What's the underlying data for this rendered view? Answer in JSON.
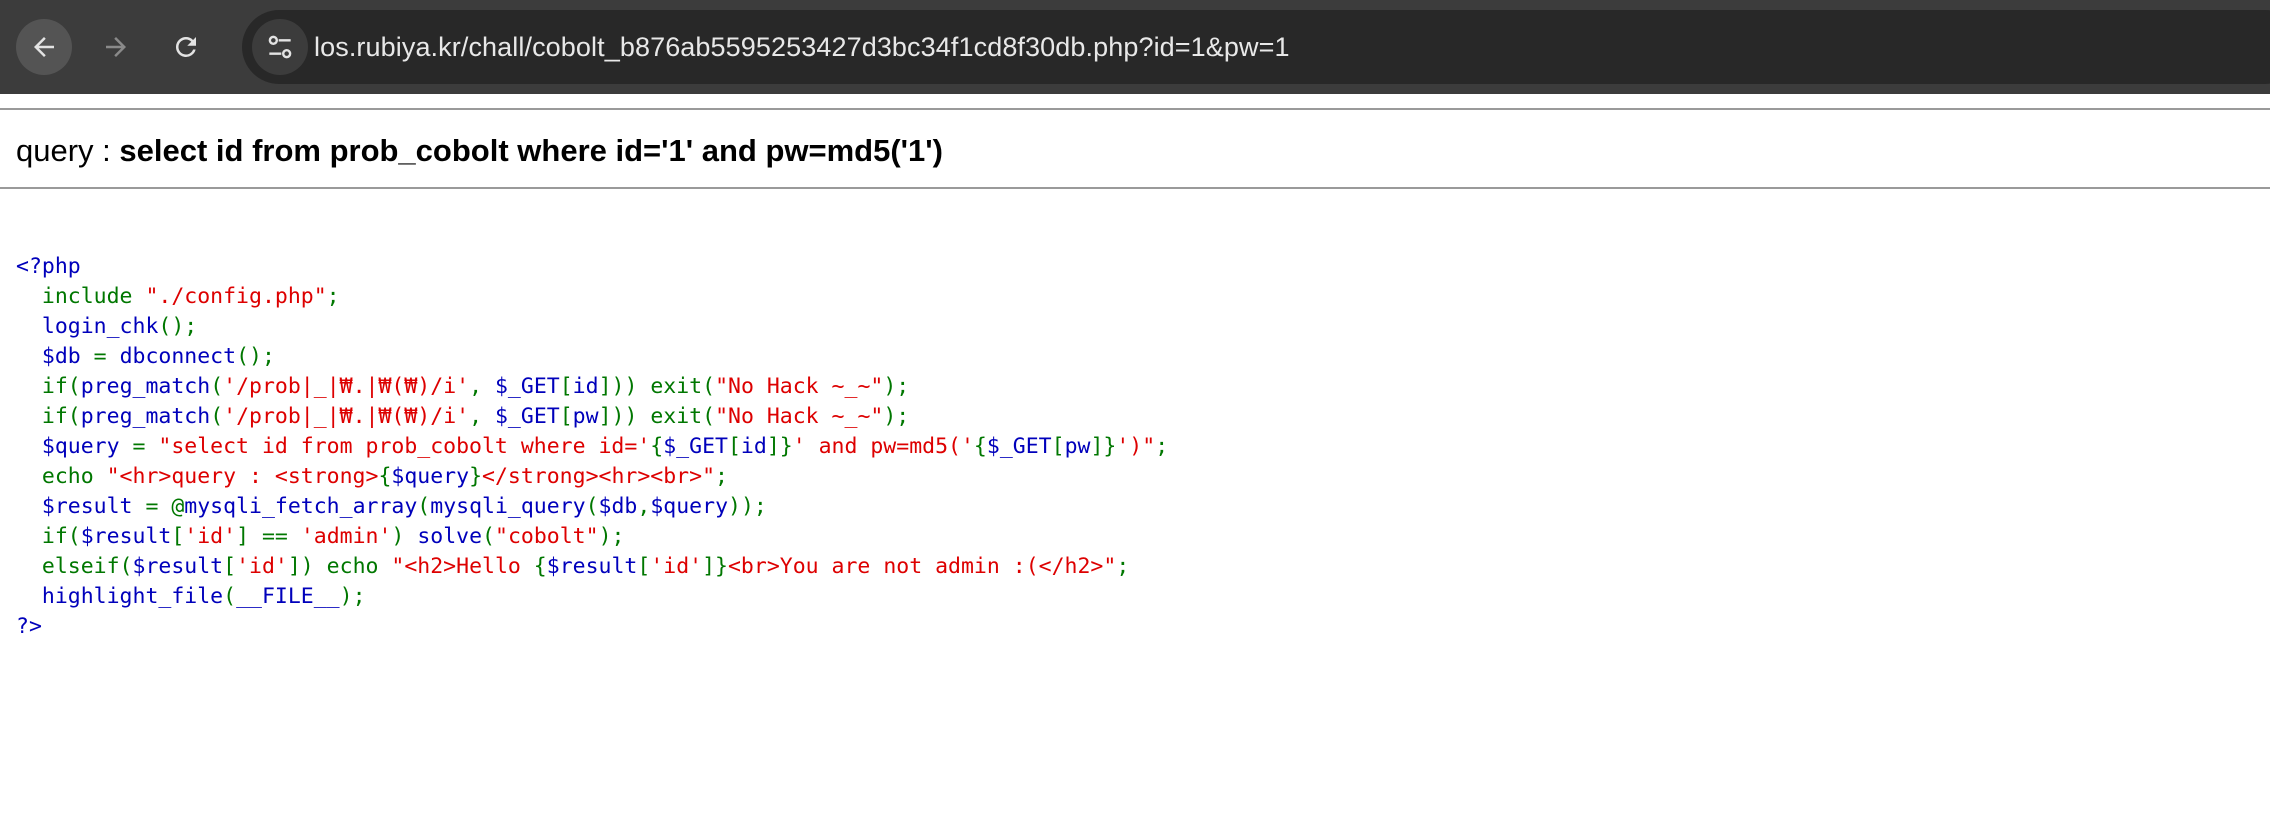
{
  "browser": {
    "url": "los.rubiya.kr/chall/cobolt_b876ab5595253427d3bc34f1cd8f30db.php?id=1&pw=1",
    "back_icon": "arrow-left-icon",
    "forward_icon": "arrow-right-icon",
    "reload_icon": "reload-icon",
    "site_info_icon": "tune-icon"
  },
  "page": {
    "query_label": "query : ",
    "query_text": "select id from prob_cobolt where id='1' and pw=md5('1')"
  },
  "source_code": [
    [
      [
        "blue",
        "<?php"
      ]
    ],
    [
      [
        "green",
        "  include "
      ],
      [
        "red",
        "\"./config.php\""
      ],
      [
        "green",
        ";"
      ]
    ],
    [
      [
        "green",
        "  "
      ],
      [
        "blue",
        "login_chk"
      ],
      [
        "green",
        "();"
      ]
    ],
    [
      [
        "green",
        "  "
      ],
      [
        "blue",
        "$db "
      ],
      [
        "green",
        "= "
      ],
      [
        "blue",
        "dbconnect"
      ],
      [
        "green",
        "();"
      ]
    ],
    [
      [
        "green",
        "  if("
      ],
      [
        "blue",
        "preg_match"
      ],
      [
        "green",
        "("
      ],
      [
        "red",
        "'/prob|_|₩.|₩(₩)/i'"
      ],
      [
        "green",
        ", "
      ],
      [
        "blue",
        "$_GET"
      ],
      [
        "green",
        "["
      ],
      [
        "blue",
        "id"
      ],
      [
        "green",
        "])) exit("
      ],
      [
        "red",
        "\"No Hack ~_~\""
      ],
      [
        "green",
        ");"
      ]
    ],
    [
      [
        "green",
        "  if("
      ],
      [
        "blue",
        "preg_match"
      ],
      [
        "green",
        "("
      ],
      [
        "red",
        "'/prob|_|₩.|₩(₩)/i'"
      ],
      [
        "green",
        ", "
      ],
      [
        "blue",
        "$_GET"
      ],
      [
        "green",
        "["
      ],
      [
        "blue",
        "pw"
      ],
      [
        "green",
        "])) exit("
      ],
      [
        "red",
        "\"No Hack ~_~\""
      ],
      [
        "green",
        ");"
      ]
    ],
    [
      [
        "green",
        "  "
      ],
      [
        "blue",
        "$query "
      ],
      [
        "green",
        "= "
      ],
      [
        "red",
        "\"select id from prob_cobolt where id='"
      ],
      [
        "green",
        "{"
      ],
      [
        "blue",
        "$_GET"
      ],
      [
        "green",
        "["
      ],
      [
        "blue",
        "id"
      ],
      [
        "green",
        "]}"
      ],
      [
        "red",
        "' and pw=md5('"
      ],
      [
        "green",
        "{"
      ],
      [
        "blue",
        "$_GET"
      ],
      [
        "green",
        "["
      ],
      [
        "blue",
        "pw"
      ],
      [
        "green",
        "]}"
      ],
      [
        "red",
        "')\""
      ],
      [
        "green",
        ";"
      ]
    ],
    [
      [
        "green",
        "  echo "
      ],
      [
        "red",
        "\"<hr>query : <strong>"
      ],
      [
        "green",
        "{"
      ],
      [
        "blue",
        "$query"
      ],
      [
        "green",
        "}"
      ],
      [
        "red",
        "</strong><hr><br>\""
      ],
      [
        "green",
        ";"
      ]
    ],
    [
      [
        "green",
        "  "
      ],
      [
        "blue",
        "$result "
      ],
      [
        "green",
        "= @"
      ],
      [
        "blue",
        "mysqli_fetch_array"
      ],
      [
        "green",
        "("
      ],
      [
        "blue",
        "mysqli_query"
      ],
      [
        "green",
        "("
      ],
      [
        "blue",
        "$db"
      ],
      [
        "green",
        ","
      ],
      [
        "blue",
        "$query"
      ],
      [
        "green",
        "));"
      ]
    ],
    [
      [
        "green",
        "  if("
      ],
      [
        "blue",
        "$result"
      ],
      [
        "green",
        "["
      ],
      [
        "red",
        "'id'"
      ],
      [
        "green",
        "] == "
      ],
      [
        "red",
        "'admin'"
      ],
      [
        "green",
        ") "
      ],
      [
        "blue",
        "solve"
      ],
      [
        "green",
        "("
      ],
      [
        "red",
        "\"cobolt\""
      ],
      [
        "green",
        ");"
      ]
    ],
    [
      [
        "green",
        "  elseif("
      ],
      [
        "blue",
        "$result"
      ],
      [
        "green",
        "["
      ],
      [
        "red",
        "'id'"
      ],
      [
        "green",
        "]) echo "
      ],
      [
        "red",
        "\"<h2>Hello "
      ],
      [
        "green",
        "{"
      ],
      [
        "blue",
        "$result"
      ],
      [
        "green",
        "["
      ],
      [
        "red",
        "'id'"
      ],
      [
        "green",
        "]}"
      ],
      [
        "red",
        "<br>You are not admin :(</h2>\""
      ],
      [
        "green",
        ";"
      ]
    ],
    [
      [
        "green",
        "  "
      ],
      [
        "blue",
        "highlight_file"
      ],
      [
        "green",
        "("
      ],
      [
        "blue",
        "__FILE__"
      ],
      [
        "green",
        ");"
      ]
    ],
    [
      [
        "blue",
        "?>"
      ]
    ]
  ]
}
